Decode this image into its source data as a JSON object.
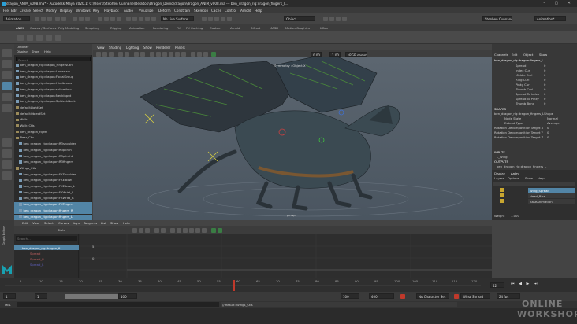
{
  "window": {
    "title": "dragon_ANIM_v008.ma* - Autodesk Maya 2020.1: C:\\Users\\Stephen Cunnane\\Desktop\\Dragon_Demo\\dragon\\dragon_ANIM_v008.ma  ---  ben_dragon_rig:dragon_fingers_L..."
  },
  "menubar": [
    "File",
    "Edit",
    "Create",
    "Select",
    "Modify",
    "Display",
    "Windows",
    "Key",
    "Playback",
    "Audio",
    "Visualize",
    "Deform",
    "Constrain",
    "Skeleton",
    "Cache",
    "Control",
    "Arnold",
    "Help"
  ],
  "statusline": {
    "mode": "Animation",
    "no_live_surface": "No Live Surface",
    "object": "Object",
    "workspace": "Animation*",
    "user": "Stephen Cunnane"
  },
  "shelf_tabs": [
    "Curves / Surfaces",
    "Poly Modeling",
    "Sculpting",
    "Rigging",
    "Animation",
    "Rendering",
    "FX",
    "FX Caching",
    "Custom",
    "Arnold",
    "Bifrost",
    "MASH",
    "Motion Graphics",
    "XGen"
  ],
  "shelf_first": "ANIM",
  "outliner": {
    "title": "Outliner",
    "menus": [
      "Display",
      "Show",
      "Help"
    ],
    "search_placeholder": "Search...",
    "items": [
      {
        "label": "ben_dragon_rig:dragon_FingersCtrl"
      },
      {
        "label": "ben_dragon_rig:dragon:LowerJaw"
      },
      {
        "label": "ben_dragon_rig:dragon:FacialGroup"
      },
      {
        "label": "ben_dragon_rig:dragon:Hindbrows"
      },
      {
        "label": "ben_dragon_rig:dragon:splineNoJo"
      },
      {
        "label": "ben_dragon_rig:dragon:NeckInput"
      },
      {
        "label": "ben_dragon_rig:dragon:SplNeckNeck"
      },
      {
        "label": "defaultLightSet"
      },
      {
        "label": "defaultObjectSet"
      },
      {
        "label": "Walk"
      },
      {
        "label": "Walk_Ctls"
      },
      {
        "label": "ben_dragon_rigMt"
      },
      {
        "label": "Rear_Ctls"
      },
      {
        "label": "ben_dragon_rig:dragon:R3shoulder"
      },
      {
        "label": "ben_dragon_rig:dragon:R3plinth"
      },
      {
        "label": "ben_dragon_rig:dragon:R3plinthL"
      },
      {
        "label": "ben_dragon_rig:dragon:R3fingers"
      },
      {
        "label": "Wings_Ctls"
      },
      {
        "label": "ben_dragon_rig:dragon:FKShoulder"
      },
      {
        "label": "ben_dragon_rig:dragon:FKElbow"
      },
      {
        "label": "ben_dragon_rig:dragon:FKElbow_L"
      },
      {
        "label": "ben_dragon_rig:dragon:FKWrist_L"
      },
      {
        "label": "ben_dragon_rig:dragon:FKWrist_R"
      },
      {
        "label": "ben_dragon_rig:dragon:FKFingers"
      },
      {
        "label": "ben_dragon_rig:dragon:fingers_R"
      },
      {
        "label": "ben_dragon_rig:dragon:fingers_L"
      }
    ]
  },
  "viewport": {
    "menus": [
      "View",
      "Shading",
      "Lighting",
      "Show",
      "Renderer",
      "Panels"
    ],
    "exposure": "0.00",
    "gamma": "1.00",
    "color_space": "sRGB gamma",
    "hud_symmetry": "Symmetry : Object X",
    "camera_label": "persp"
  },
  "channel_box": {
    "tabs": [
      "Channels",
      "Edit",
      "Object",
      "Show"
    ],
    "object": "ben_dragon_rig:dragon:fingers_L",
    "channels": [
      {
        "name": "Spread",
        "value": "0"
      },
      {
        "name": "Index Curl",
        "value": "0"
      },
      {
        "name": "Middle Curl",
        "value": "0"
      },
      {
        "name": "Ring Curl",
        "value": "0"
      },
      {
        "name": "Pinky Curl",
        "value": "0"
      },
      {
        "name": "Thumb Curl",
        "value": "0"
      },
      {
        "name": "Spread To Index",
        "value": "0"
      },
      {
        "name": "Spread To Pinky",
        "value": "0"
      },
      {
        "name": "Thumb Bend",
        "value": "0"
      }
    ],
    "shapes_label": "SHAPES",
    "shape_name": "ben_dragon_rig:dragon_fingers_LShape",
    "shape_channels": [
      {
        "name": "Node State",
        "value": "Normal"
      },
      {
        "name": "Extend Type",
        "value": "Average"
      },
      {
        "name": "Rotation Decomposition Target X",
        "value": "0"
      },
      {
        "name": "Rotation Decomposition Target Y",
        "value": "0"
      },
      {
        "name": "Rotation Decomposition Target Z",
        "value": "0"
      }
    ],
    "inputs_label": "INPUTS",
    "input_name": "L_Wing",
    "outputs_label": "OUTPUTS",
    "output_name": "ben_dragon_rig:dragon_fingers_L"
  },
  "layer_editor": {
    "tabs": [
      "Display",
      "Anim"
    ],
    "menus": [
      "Layers",
      "Options",
      "Show",
      "Help"
    ],
    "layers": [
      {
        "name": "Wing_Spread",
        "selected": true
      },
      {
        "name": "Head_Rise",
        "selected": false
      },
      {
        "name": "BaseAnimation",
        "selected": false
      }
    ],
    "weight_label": "Weight",
    "weight_value": "1.000"
  },
  "graph_editor": {
    "title": "Graph Editor",
    "menus": [
      "Edit",
      "View",
      "Select",
      "Curves",
      "Keys",
      "Tangents",
      "List",
      "Show",
      "Help"
    ],
    "stats_label": "Stats",
    "search_placeholder": "Search...",
    "tree": [
      {
        "label": "ben_dragon_rig:dragon_fi"
      },
      {
        "label": "Spread"
      },
      {
        "label": "Spread_R"
      },
      {
        "label": "Spread_L"
      }
    ],
    "y_labels": [
      "5",
      "0"
    ],
    "x_labels": [
      "0",
      "20",
      "40",
      "60",
      "80",
      "100"
    ]
  },
  "timeline": {
    "ticks": [
      "5",
      "10",
      "15",
      "20",
      "25",
      "30",
      "35",
      "40",
      "45",
      "50",
      "55",
      "60",
      "65",
      "70",
      "75",
      "80",
      "85",
      "90",
      "95",
      "100",
      "105",
      "110",
      "115",
      "120"
    ],
    "current_frame": "42",
    "range_start": "1",
    "range_inner_start": "1",
    "range_inner_end": "100",
    "range_end": "100",
    "playback_end": "400",
    "character_set": "No Character Set",
    "anim_layer": "Wing_Spread",
    "fps": "24 fps"
  },
  "bottom": {
    "mel": "MEL",
    "result": "// Result: Wings_Ctls",
    "watermark_line1": "ONLINE",
    "watermark_line2": "WORKSHOP"
  },
  "colors": {
    "accent": "#5285a6",
    "selection": "#5285a6",
    "playhead": "#c0392b"
  }
}
